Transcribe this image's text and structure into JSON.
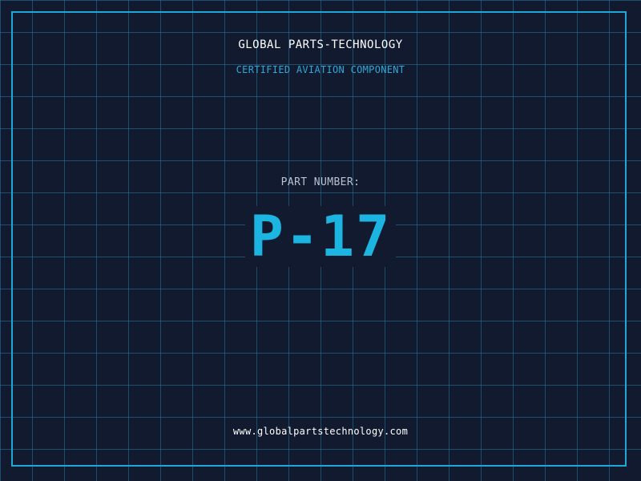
{
  "brand": {
    "name": "GLOBAL PARTS-TECHNOLOGY",
    "tagline": "CERTIFIED AVIATION COMPONENT"
  },
  "part": {
    "label": "PART NUMBER:",
    "number": "P-17"
  },
  "footer": {
    "website": "www.globalpartstechnology.com"
  },
  "colors": {
    "background": "#111a2e",
    "grid": "#28789f",
    "frame": "#1fa8d6",
    "accent": "#1cb4e0",
    "label": "#b9c2d0",
    "text": "#ffffff"
  }
}
